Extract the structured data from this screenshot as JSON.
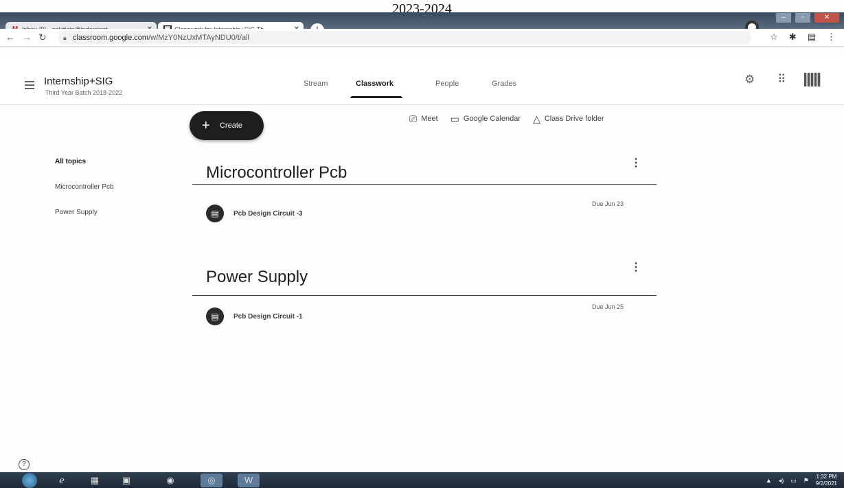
{
  "document_header": "2023-2024",
  "browser": {
    "tabs": [
      {
        "label": "Inbox (9) - ankitjain@indoreinst",
        "icon": "gmail-icon"
      },
      {
        "label": "Classwork for Internship+SIG Th",
        "icon": "classroom-icon"
      }
    ],
    "new_tab_symbol": "+",
    "url_host": "classroom.google.com",
    "url_path": "/w/MzY0NzUxMTAyNDU0/t/all"
  },
  "classroom": {
    "class_name": "Internship+SIG",
    "class_subtitle": "Third Year Batch 2018-2022",
    "tabs": [
      "Stream",
      "Classwork",
      "People",
      "Grades"
    ],
    "active_tab": "Classwork",
    "create_label": "Create",
    "quick_links": {
      "meet": "Meet",
      "calendar": "Google Calendar",
      "drive": "Class Drive folder"
    },
    "side_nav": [
      "All topics",
      "Microcontroller Pcb",
      "Power Supply"
    ],
    "topics": [
      {
        "title": "Microcontroller Pcb",
        "assignments": [
          {
            "title": "Pcb Design Circuit -3",
            "due": "Due Jun 23"
          }
        ]
      },
      {
        "title": "Power Supply",
        "assignments": [
          {
            "title": "Pcb Design Circuit -1",
            "due": "Due Jun 25"
          }
        ]
      }
    ]
  },
  "taskbar": {
    "time": "1:32 PM",
    "date": "9/2/2021"
  }
}
